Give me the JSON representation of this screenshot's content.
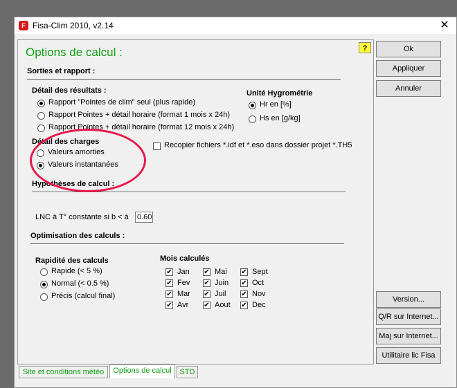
{
  "window": {
    "title": "Fisa-Clim 2010, v2.14",
    "close_glyph": "✕",
    "app_icon_glyph": "F"
  },
  "page_title": "Options de calcul :",
  "help_glyph": "?",
  "sections": {
    "sorties": "Sorties et rapport :",
    "hypotheses": "Hypothèses de calcul :",
    "optimisation": "Optimisation des calculs :"
  },
  "detail_resultats": {
    "label": "Détail des résultats :",
    "options": [
      {
        "label": "Rapport \"Pointes de clim\" seul (plus rapide)",
        "selected": true
      },
      {
        "label": "Rapport Pointes + détail horaire (format 1 mois x 24h)",
        "selected": false
      },
      {
        "label": "Rapport Pointes + détail horaire (format 12 mois x 24h)",
        "selected": false
      }
    ]
  },
  "unite_hygrometrie": {
    "label": "Unité Hygrométrie",
    "options": [
      {
        "label": "Hr en [%]",
        "selected": true
      },
      {
        "label": "Hs en [g/kg]",
        "selected": false
      }
    ]
  },
  "detail_charges": {
    "label": "Détail des charges",
    "options": [
      {
        "label": "Valeurs amorties",
        "selected": false
      },
      {
        "label": "Valeurs instantanées",
        "selected": true
      }
    ]
  },
  "recopier": {
    "label": "Recopier fichiers *.idf et *.eso dans dossier projet *.TH5",
    "checked": false
  },
  "lnc": {
    "label": "LNC à T° constante si b < à",
    "value": "0.60"
  },
  "rapidite": {
    "label": "Rapidité des calculs",
    "options": [
      {
        "label": "Rapide (< 5 %)",
        "selected": false
      },
      {
        "label": "Normal (< 0.5 %)",
        "selected": true
      },
      {
        "label": "Précis (calcul final)",
        "selected": false
      }
    ]
  },
  "mois": {
    "label": "Mois calculés",
    "months": [
      "Jan",
      "Fev",
      "Mar",
      "Avr",
      "Mai",
      "Juin",
      "Juil",
      "Aout",
      "Sept",
      "Oct",
      "Nov",
      "Dec"
    ],
    "checked": true
  },
  "buttons": {
    "ok": "Ok",
    "appliquer": "Appliquer",
    "annuler": "Annuler",
    "version": "Version...",
    "qr": "Q/R sur Internet...",
    "maj": "Maj sur Internet...",
    "utilitaire": "Utilitaire lic Fisa"
  },
  "tabs": [
    {
      "label": "Site et conditions météo",
      "active": false
    },
    {
      "label": "Options de calcul",
      "active": true
    },
    {
      "label": "STD",
      "active": false
    }
  ],
  "colors": {
    "accent_green": "#12a012",
    "highlight_circle": "#e8184c",
    "help_yellow": "#ffff33"
  }
}
